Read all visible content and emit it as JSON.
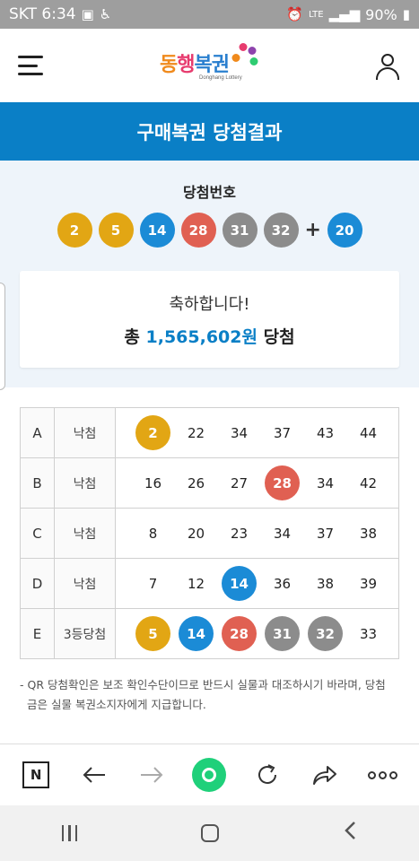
{
  "status": {
    "carrier_time": "SKT 6:34",
    "network": "LTE",
    "battery": "90%"
  },
  "header": {
    "logo_text": [
      "동",
      "행",
      "복권"
    ],
    "logo_sub": "Donghang Lottery"
  },
  "page_title": "구매복권 당첨결과",
  "winning": {
    "label": "당첨번호",
    "numbers": [
      "2",
      "5",
      "14",
      "28",
      "31",
      "32"
    ],
    "plus": "+",
    "bonus": "20"
  },
  "congrats": {
    "message": "축하합니다!",
    "prefix": "총",
    "amount": "1,565,602원",
    "suffix": "당첨"
  },
  "rows": [
    {
      "key": "A",
      "result": "낙첨",
      "numbers": [
        "2",
        "22",
        "34",
        "37",
        "43",
        "44"
      ]
    },
    {
      "key": "B",
      "result": "낙첨",
      "numbers": [
        "16",
        "26",
        "27",
        "28",
        "34",
        "42"
      ]
    },
    {
      "key": "C",
      "result": "낙첨",
      "numbers": [
        "8",
        "20",
        "23",
        "34",
        "37",
        "38"
      ]
    },
    {
      "key": "D",
      "result": "낙첨",
      "numbers": [
        "7",
        "12",
        "14",
        "36",
        "38",
        "39"
      ]
    },
    {
      "key": "E",
      "result": "3등당첨",
      "numbers": [
        "5",
        "14",
        "28",
        "31",
        "32",
        "33"
      ]
    }
  ],
  "note_line1": "- QR 당첨확인은 보조 확인수단이므로 반드시 실물과 대조하시기 바라며, 당첨",
  "note_line2": "금은 실물 복권소지자에게 지급합니다.",
  "toolbar": {
    "n_label": "N"
  },
  "colors": {
    "brand_blue": "#0a7fc6",
    "ball_yellow": "#e2a614",
    "ball_blue": "#1b8bd6",
    "ball_red": "#e06052",
    "ball_gray": "#8c8c8c",
    "accent_green": "#1fd07a"
  }
}
